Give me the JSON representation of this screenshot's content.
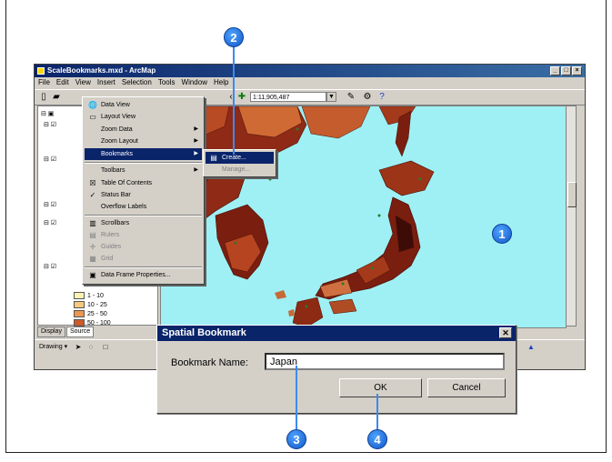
{
  "window": {
    "title": "ScaleBookmarks.mxd - ArcMap"
  },
  "menubar": [
    "File",
    "Edit",
    "View",
    "Insert",
    "Selection",
    "Tools",
    "Window",
    "Help"
  ],
  "toolbar": {
    "scale": "1:11,905,487"
  },
  "view_menu": {
    "items": [
      {
        "label": "Data View",
        "icon": "globe-icon"
      },
      {
        "label": "Layout View",
        "icon": "page-icon"
      },
      {
        "label": "Zoom Data",
        "submenu": true
      },
      {
        "label": "Zoom Layout",
        "submenu": true
      },
      {
        "label": "Bookmarks",
        "submenu": true,
        "highlighted": true
      },
      {
        "label": "Toolbars",
        "submenu": true
      },
      {
        "label": "Table Of Contents",
        "checked": true
      },
      {
        "label": "Status Bar",
        "checked": true
      },
      {
        "label": "Overflow Labels"
      },
      {
        "label": "Scrollbars"
      },
      {
        "label": "Rulers",
        "disabled": true
      },
      {
        "label": "Guides",
        "disabled": true
      },
      {
        "label": "Grid",
        "disabled": true
      },
      {
        "label": "Data Frame Properties..."
      }
    ]
  },
  "bookmarks_submenu": {
    "items": [
      "Create...",
      "Manage..."
    ]
  },
  "toc": {
    "legend": [
      "1 - 10",
      "10 - 25",
      "25 - 50",
      "50 - 100"
    ],
    "tabs": [
      "Display",
      "Source"
    ]
  },
  "status": {
    "drawing_label": "Drawing"
  },
  "dialog": {
    "title": "Spatial Bookmark",
    "label": "Bookmark Name:",
    "value": "Japan",
    "ok": "OK",
    "cancel": "Cancel"
  },
  "callouts": [
    "1",
    "2",
    "3",
    "4"
  ],
  "colors": {
    "titlebar": "#0a246a",
    "map_water": "#9ff0f4",
    "callout": "#1f6fe0"
  }
}
